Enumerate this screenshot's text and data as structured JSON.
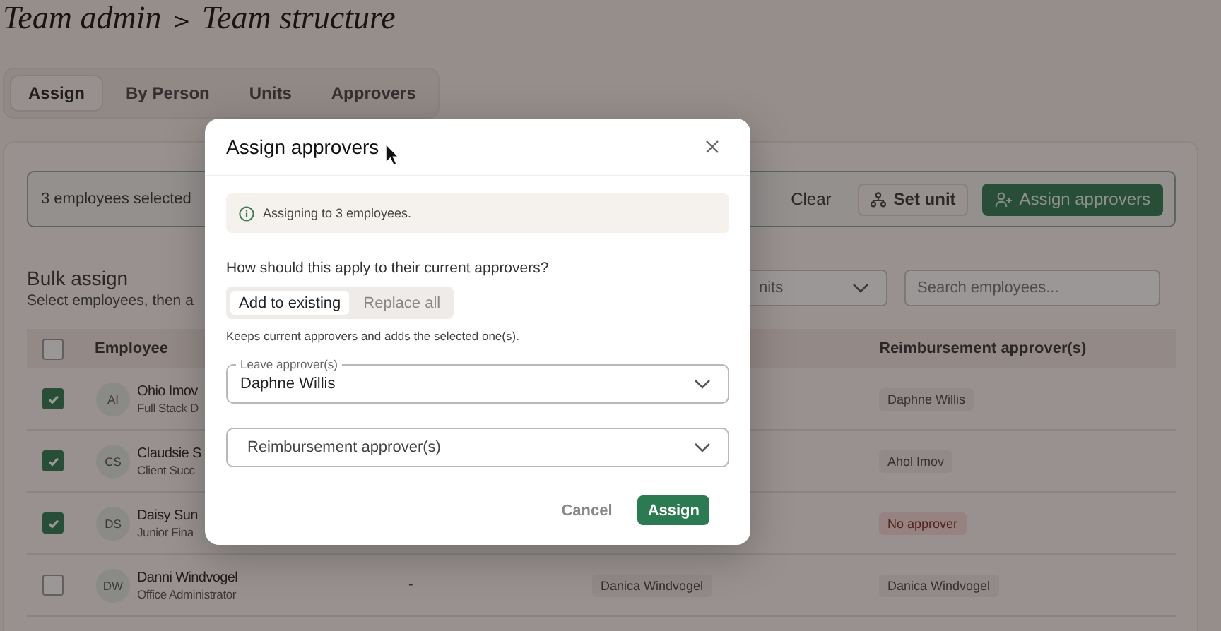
{
  "breadcrumb": {
    "parent": "Team admin",
    "separator": ">",
    "current": "Team structure"
  },
  "tabs": [
    {
      "label": "Assign",
      "selected": true
    },
    {
      "label": "By Person",
      "selected": false
    },
    {
      "label": "Units",
      "selected": false
    },
    {
      "label": "Approvers",
      "selected": false
    }
  ],
  "selection_bar": {
    "text": "3 employees selected",
    "actions": [
      {
        "label": "Clear",
        "kind": "link"
      },
      {
        "label": "Set unit",
        "kind": "outline"
      },
      {
        "label": "Assign approvers",
        "kind": "primary"
      }
    ]
  },
  "bulk": {
    "title": "Bulk assign",
    "subtitle": "Select employees, then a",
    "unit_filter": "nits",
    "search": {
      "placeholder": "Search employees..."
    }
  },
  "table": {
    "header_checked": false,
    "employee_header": "Employee",
    "reimbursement_header": "Reimbursement approver(s)",
    "rows": [
      {
        "checked": true,
        "initials": "AI",
        "name": "Ohio Imov",
        "role": "Full Stack D",
        "reimbursement": {
          "text": "Daphne Willis",
          "kind": "tag"
        }
      },
      {
        "checked": true,
        "initials": "CS",
        "name": "Claudsie S",
        "role": "Client Succ",
        "reimbursement": {
          "text": "Ahol Imov",
          "kind": "tag"
        }
      },
      {
        "checked": true,
        "initials": "DS",
        "name": "Daisy Sun",
        "role": "Junior Fina",
        "reimbursement": {
          "text": "No approver",
          "kind": "warning"
        }
      },
      {
        "checked": false,
        "initials": "DW",
        "name": "Danni Windvogel",
        "role": "Office Administrator",
        "column_2": "-",
        "column_3": {
          "text": "Danica Windvogel",
          "kind": "tag"
        },
        "reimbursement": {
          "text": "Danica Windvogel",
          "kind": "tag"
        }
      }
    ]
  },
  "dialog": {
    "title": "Assign approvers",
    "info": "Assigning to 3 employees.",
    "question": "How should this apply to their current approvers?",
    "modes": [
      {
        "label": "Add to existing",
        "selected": true
      },
      {
        "label": "Replace all",
        "selected": false
      }
    ],
    "hint": "Keeps current approvers and adds the selected one(s).",
    "fields": [
      {
        "label": "Leave approver(s)",
        "value": "Daphne Willis"
      },
      {
        "placeholder": "Reimbursement approver(s)"
      }
    ],
    "buttons": [
      {
        "label": "Cancel",
        "kind": "text"
      },
      {
        "label": "Assign",
        "kind": "primary"
      }
    ]
  }
}
